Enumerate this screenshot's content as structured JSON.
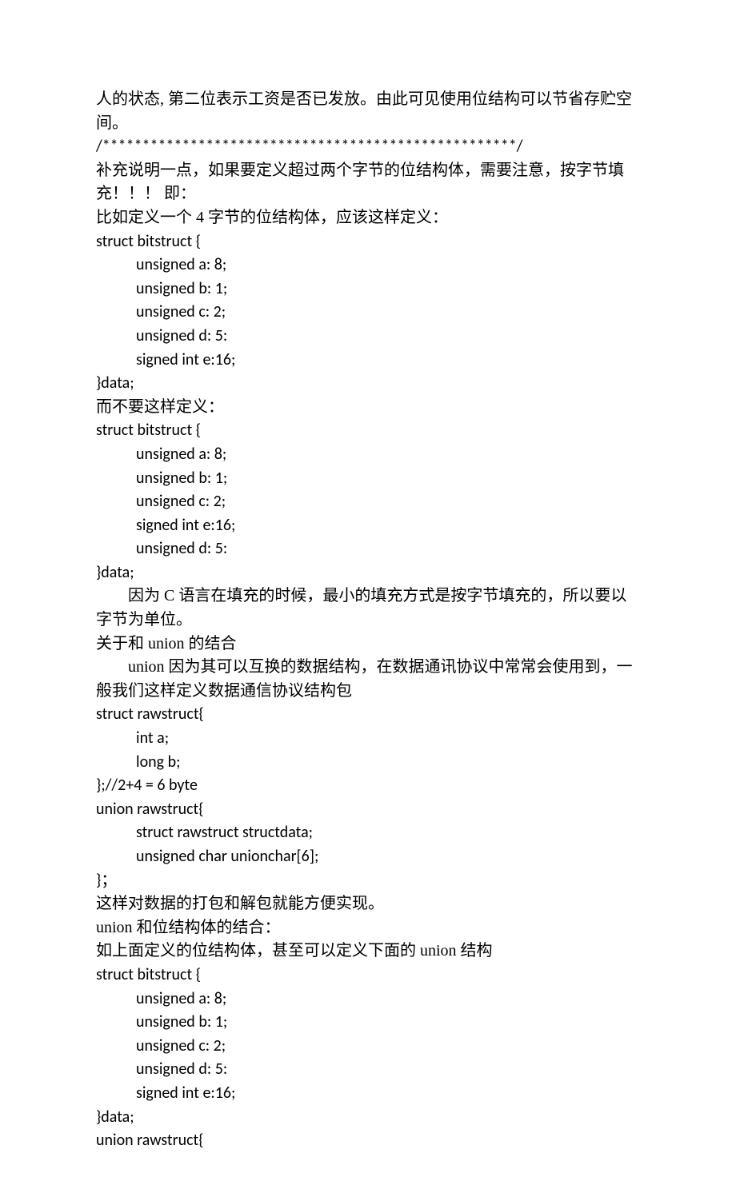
{
  "p1": "人的状态, 第二位表示工资是否已发放。由此可见使用位结构可以节省存贮空间。",
  "p2": "/****************************************************/",
  "p3": "补充说明一点，如果要定义超过两个字节的位结构体，需要注意，按字节填充！！！ 即：",
  "p4": "比如定义一个 4 字节的位结构体，应该这样定义：",
  "s1_l1": "struct bitstruct {",
  "s1_a": "unsigned a: 8;",
  "s1_b": "unsigned b: 1;",
  "s1_c": "unsigned c: 2;",
  "s1_d": "unsigned d: 5:",
  "s1_e": "signed int e:16;",
  "s1_end": "}data;",
  "p5": "而不要这样定义：",
  "s2_l1": "struct bitstruct {",
  "s2_a": "unsigned a: 8;",
  "s2_b": "unsigned b: 1;",
  "s2_c": "unsigned c: 2;",
  "s2_e": "signed int e:16;",
  "s2_d": "unsigned d: 5:",
  "s2_end": "}data;",
  "p6": "因为 C 语言在填充的时候，最小的填充方式是按字节填充的，所以要以字节为单位。",
  "p7": "关于和 union 的结合",
  "p8": "union 因为其可以互换的数据结构，在数据通讯协议中常常会使用到，一般我们这样定义数据通信协议结构包",
  "s3_l1": "struct rawstruct{",
  "s3_a": "int a;",
  "s3_b": "long b;",
  "s3_end": "};//2+4 = 6 byte",
  "u1_l1": "union rawstruct{",
  "u1_a": "struct rawstruct structdata;",
  "u1_b": "unsigned char  unionchar[6];",
  "u1_end": "}；",
  "p9": "这样对数据的打包和解包就能方便实现。",
  "p10": "union 和位结构体的结合：",
  "p11": "如上面定义的位结构体，甚至可以定义下面的 union 结构",
  "s4_l1": "struct bitstruct {",
  "s4_a": "unsigned a: 8;",
  "s4_b": "unsigned b: 1;",
  "s4_c": "unsigned c: 2;",
  "s4_d": "unsigned d: 5:",
  "s4_e": "signed int e:16;",
  "s4_end": "}data;",
  "u2_l1": "union rawstruct{"
}
